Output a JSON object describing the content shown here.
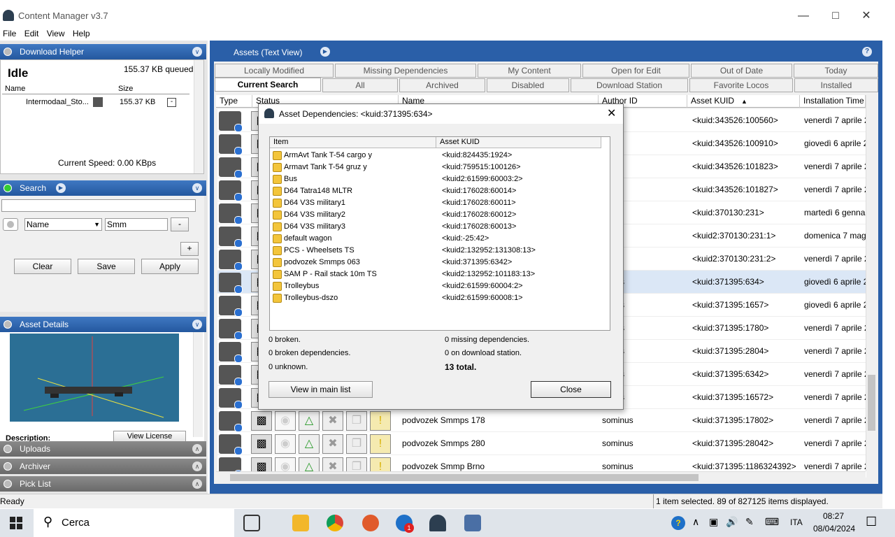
{
  "window": {
    "title": "Content Manager v3.7"
  },
  "menu": [
    "File",
    "Edit",
    "View",
    "Help"
  ],
  "download_helper": {
    "title": "Download Helper",
    "state": "Idle",
    "queued": "155.37 KB queued",
    "columns": {
      "name": "Name",
      "size": "Size"
    },
    "item": {
      "name": "Intermodaal_Sto...",
      "size": "155.37 KB"
    },
    "speed": "Current Speed:  0.00 KBps"
  },
  "search": {
    "title": "Search",
    "query": "",
    "field": "Name",
    "value": "Smm",
    "minus": "-",
    "plus": "+",
    "clear": "Clear",
    "save": "Save",
    "apply": "Apply"
  },
  "asset_details": {
    "title": "Asset Details",
    "description_label": "Description:",
    "view_license": "View License"
  },
  "collapsed_panels": [
    "Uploads",
    "Archiver",
    "Pick List"
  ],
  "main": {
    "title": "Assets (Text View)",
    "tabs_row1": [
      "Locally Modified",
      "Missing Dependencies",
      "My Content",
      "Open for Edit",
      "Out of Date",
      "Today"
    ],
    "tabs_row2": [
      "Current Search",
      "All",
      "Archived",
      "Disabled",
      "Download Station",
      "Favorite Locos",
      "Installed"
    ],
    "columns": [
      "Type",
      "Status",
      "Name",
      "Author ID",
      "Asset KUID",
      "Installation Time"
    ],
    "rows": [
      {
        "name": "",
        "author": "nge",
        "kuid": "<kuid:343526:100560>",
        "time": "venerdì 7 aprile 2"
      },
      {
        "name": "",
        "author": "nge",
        "kuid": "<kuid:343526:100910>",
        "time": "giovedì 6 aprile 2"
      },
      {
        "name": "",
        "author": "nge",
        "kuid": "<kuid:343526:101823>",
        "time": "venerdì 7 aprile 2"
      },
      {
        "name": "",
        "author": "nge",
        "kuid": "<kuid:343526:101827>",
        "time": "venerdì 7 aprile 2"
      },
      {
        "name": "",
        "author": "",
        "kuid": "<kuid:370130:231>",
        "time": "martedì 6 genna"
      },
      {
        "name": "",
        "author": "",
        "kuid": "<kuid2:370130:231:1>",
        "time": "domenica 7 mag"
      },
      {
        "name": "",
        "author": "",
        "kuid": "<kuid2:370130:231:2>",
        "time": "venerdì 7 aprile 2"
      },
      {
        "name": "",
        "author": "minus",
        "kuid": "<kuid:371395:634>",
        "time": "giovedì 6 aprile 2"
      },
      {
        "name": "",
        "author": "minus",
        "kuid": "<kuid:371395:1657>",
        "time": "giovedì 6 aprile 2"
      },
      {
        "name": "",
        "author": "minus",
        "kuid": "<kuid:371395:1780>",
        "time": "venerdì 7 aprile 2"
      },
      {
        "name": "",
        "author": "minus",
        "kuid": "<kuid:371395:2804>",
        "time": "venerdì 7 aprile 2"
      },
      {
        "name": "",
        "author": "minus",
        "kuid": "<kuid:371395:6342>",
        "time": "venerdì 7 aprile 2"
      },
      {
        "name": "",
        "author": "minus",
        "kuid": "<kuid:371395:16572>",
        "time": "venerdì 7 aprile 2"
      },
      {
        "name": "podvozek Smmps 178",
        "author": "sominus",
        "kuid": "<kuid:371395:17802>",
        "time": "venerdì 7 aprile 2"
      },
      {
        "name": "podvozek Smmps 280",
        "author": "sominus",
        "kuid": "<kuid:371395:28042>",
        "time": "venerdì 7 aprile 2"
      },
      {
        "name": "podvozek Smmp Brno",
        "author": "sominus",
        "kuid": "<kuid:371395:1186324392>",
        "time": "venerdì 7 aprile 2"
      }
    ]
  },
  "dialog": {
    "title": "Asset Dependencies: <kuid:371395:634>",
    "columns": {
      "item": "Item",
      "kuid": "Asset KUID"
    },
    "items": [
      {
        "name": "ArmAvt Tank T-54 cargo y",
        "kuid": "<kuid:824435:1924>"
      },
      {
        "name": "Armavt Tank T-54 gruz y",
        "kuid": "<kuid:759515:100126>"
      },
      {
        "name": "Bus",
        "kuid": "<kuid2:61599:60003:2>"
      },
      {
        "name": "D64 Tatra148 MLTR",
        "kuid": "<kuid:176028:60014>"
      },
      {
        "name": "D64 V3S military1",
        "kuid": "<kuid:176028:60011>"
      },
      {
        "name": "D64 V3S military2",
        "kuid": "<kuid:176028:60012>"
      },
      {
        "name": "D64 V3S military3",
        "kuid": "<kuid:176028:60013>"
      },
      {
        "name": "default wagon",
        "kuid": "<kuid:-25:42>"
      },
      {
        "name": "PCS - Wheelsets TS",
        "kuid": "<kuid2:132952:131308:13>"
      },
      {
        "name": "podvozek Smmps 063",
        "kuid": "<kuid:371395:6342>"
      },
      {
        "name": "SAM P - Rail stack 10m TS",
        "kuid": "<kuid2:132952:101183:13>"
      },
      {
        "name": "Trolleybus",
        "kuid": "<kuid2:61599:60004:2>"
      },
      {
        "name": "Trolleybus-dszo",
        "kuid": "<kuid2:61599:60008:1>"
      }
    ],
    "stats": {
      "broken": "0 broken.",
      "broken_deps": "0 broken dependencies.",
      "unknown": "0 unknown.",
      "missing": "0 missing dependencies.",
      "download_station": "0 on download station.",
      "total": "13 total."
    },
    "view_button": "View in main list",
    "close_button": "Close"
  },
  "status": {
    "left": "Ready",
    "right": "1 item selected. 89 of 827125 items displayed."
  },
  "taskbar": {
    "search": "Cerca",
    "lang": "ITA",
    "time": "08:27",
    "date": "08/04/2024",
    "badge": "1"
  }
}
